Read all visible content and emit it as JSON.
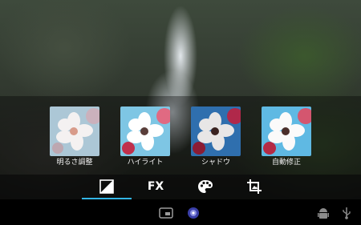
{
  "effects": [
    {
      "label": "明るさ調整",
      "tint": "#c9dbe8"
    },
    {
      "label": "ハイライト",
      "tint": "#8fd0ea"
    },
    {
      "label": "シャドウ",
      "tint": "#3a78b4"
    },
    {
      "label": "自動修正",
      "tint": "#6cc2e6"
    }
  ],
  "toolbar": {
    "tools": [
      {
        "name": "adjust",
        "icon": "half-square-icon",
        "selected": true
      },
      {
        "name": "fx",
        "label": "FX",
        "selected": false
      },
      {
        "name": "color",
        "icon": "palette-icon",
        "selected": false
      },
      {
        "name": "crop",
        "icon": "crop-icon",
        "selected": false
      }
    ],
    "accent": "#33b5e5"
  },
  "system_bar": {
    "icons": [
      "recent-apps-icon",
      "app-badge-icon",
      "android-debug-icon",
      "usb-icon"
    ]
  }
}
